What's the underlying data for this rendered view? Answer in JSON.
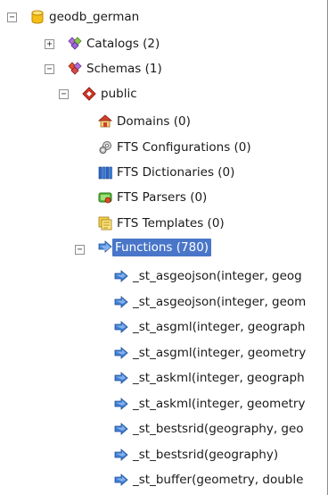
{
  "tree": {
    "database": {
      "label": "geodb_german",
      "toggle": "−"
    },
    "catalogs": {
      "label": "Catalogs (2)",
      "toggle": "+"
    },
    "schemas": {
      "label": "Schemas (1)",
      "toggle": "−"
    },
    "public": {
      "label": "public",
      "toggle": "−"
    },
    "domains": {
      "label": "Domains (0)"
    },
    "fts_configurations": {
      "label": "FTS Configurations (0)"
    },
    "fts_dictionaries": {
      "label": "FTS Dictionaries (0)"
    },
    "fts_parsers": {
      "label": "FTS Parsers (0)"
    },
    "fts_templates": {
      "label": "FTS Templates (0)"
    },
    "functions": {
      "label": "Functions (780)",
      "toggle": "−",
      "selected": true
    },
    "function_items": [
      {
        "label": "_st_asgeojson(integer, geog"
      },
      {
        "label": "_st_asgeojson(integer, geom"
      },
      {
        "label": "_st_asgml(integer, geograph"
      },
      {
        "label": "_st_asgml(integer, geometry"
      },
      {
        "label": "_st_askml(integer, geograph"
      },
      {
        "label": "_st_askml(integer, geometry"
      },
      {
        "label": "_st_bestsrid(geography, geo"
      },
      {
        "label": "_st_bestsrid(geography)"
      },
      {
        "label": "_st_buffer(geometry, double"
      }
    ]
  },
  "colors": {
    "selection": "#4a76c9",
    "function_icon": "#3f7fd6",
    "database_icon": "#f0b400"
  }
}
